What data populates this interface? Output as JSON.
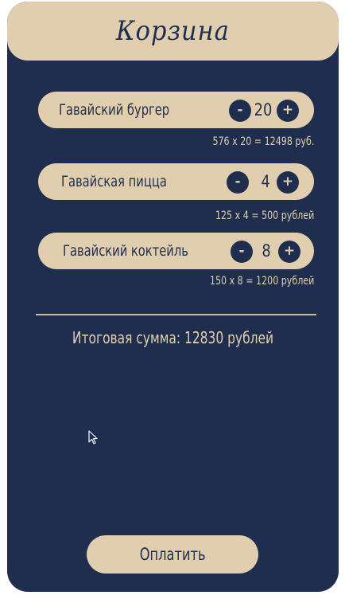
{
  "cart": {
    "title": "Корзина",
    "items": [
      {
        "name": "Гавайский бургер",
        "quantity": "20",
        "minus_label": "-",
        "plus_label": "+",
        "calc_text": "576 x 20 = 12498 руб."
      },
      {
        "name": "Гавайская пицца",
        "quantity": "4",
        "minus_label": "-",
        "plus_label": "+",
        "calc_text": "125 x 4 = 500 рублей"
      },
      {
        "name": "Гавайский коктейль",
        "quantity": "8",
        "minus_label": "-",
        "plus_label": "+",
        "calc_text": "150 x 8 = 1200 рублей"
      }
    ],
    "total_text": "Итоговая сумма: 12830 рублей",
    "pay_label": "Оплатить"
  },
  "colors": {
    "panel_background": "#1f2e4e",
    "accent_beige": "#e0ceae",
    "page_background": "#ffffff"
  },
  "icons": {
    "cursor": "arrow-cursor-icon"
  }
}
